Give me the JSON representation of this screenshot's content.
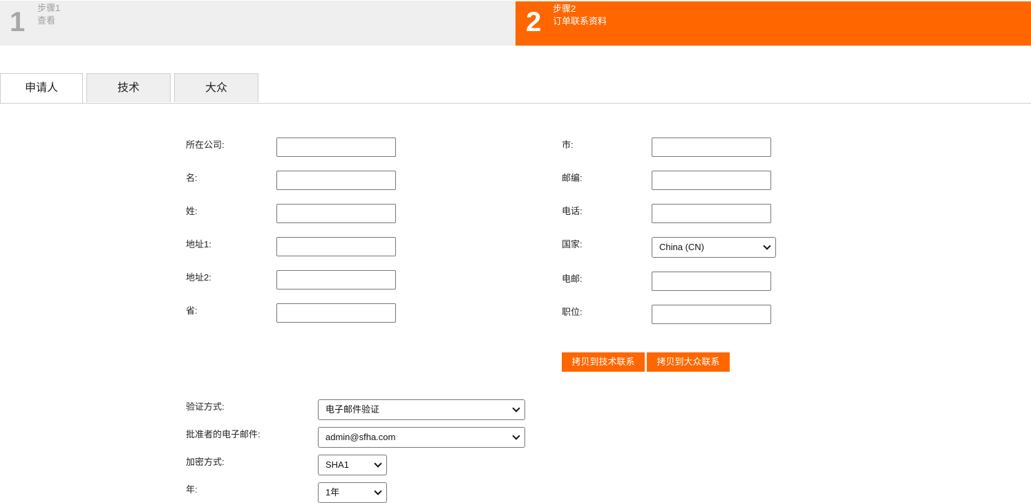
{
  "steps": [
    {
      "number": "1",
      "title": "步骤1",
      "subtitle": "查看"
    },
    {
      "number": "2",
      "title": "步骤2",
      "subtitle": "订单联系资料"
    }
  ],
  "tabs": [
    {
      "label": "申请人"
    },
    {
      "label": "技术"
    },
    {
      "label": "大众"
    }
  ],
  "form_left": {
    "company": "所在公司:",
    "first_name": "名:",
    "last_name": "姓:",
    "address1": "地址1:",
    "address2": "地址2:",
    "province": "省:"
  },
  "form_right": {
    "city": "市:",
    "postcode": "邮编:",
    "phone": "电话:",
    "country": "国家:",
    "country_value": "China (CN)",
    "email": "电邮:",
    "position": "职位:"
  },
  "buttons": {
    "copy_tech": "拷贝到技术联系",
    "copy_public": "拷贝到大众联系"
  },
  "validation": {
    "method_label": "验证方式:",
    "method_value": "电子邮件验证",
    "approver_label": "批准者的电子邮件:",
    "approver_value": "admin@sfha.com",
    "encryption_label": "加密方式:",
    "encryption_value": "SHA1",
    "years_label": "年:",
    "years_value": "1年"
  }
}
